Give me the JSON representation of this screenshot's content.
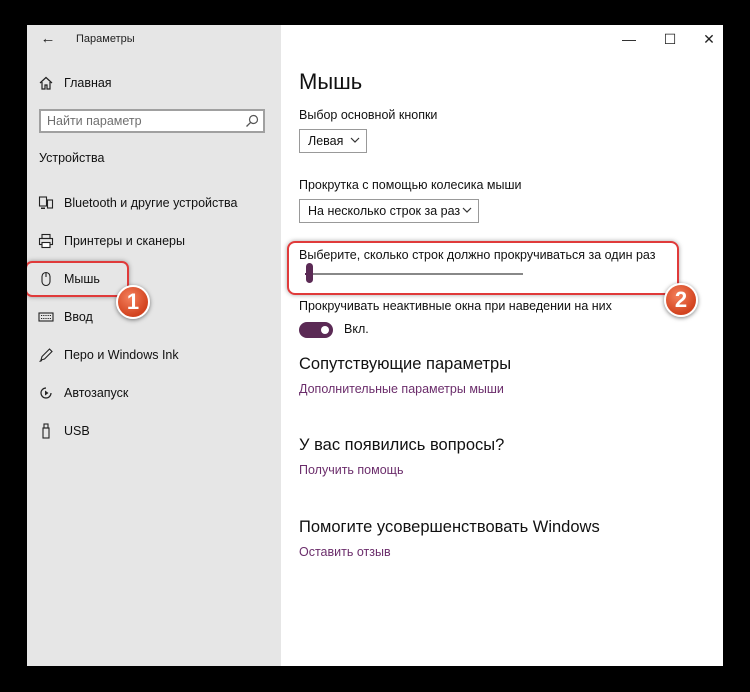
{
  "window": {
    "title": "Параметры",
    "back_icon": "back-arrow-icon",
    "controls": [
      "minimize",
      "maximize",
      "close"
    ]
  },
  "sidebar": {
    "home_label": "Главная",
    "search_placeholder": "Найти параметр",
    "section_title": "Устройства",
    "items": [
      {
        "label": "Bluetooth и другие устройства",
        "icon": "bluetooth-devices-icon"
      },
      {
        "label": "Принтеры и сканеры",
        "icon": "printer-icon"
      },
      {
        "label": "Мышь",
        "icon": "mouse-icon",
        "selected": true
      },
      {
        "label": "Ввод",
        "icon": "keyboard-icon"
      },
      {
        "label": "Перо и Windows Ink",
        "icon": "pen-icon"
      },
      {
        "label": "Автозапуск",
        "icon": "autoplay-icon"
      },
      {
        "label": "USB",
        "icon": "usb-icon"
      }
    ]
  },
  "main": {
    "title": "Мышь",
    "primary_button": {
      "label": "Выбор основной кнопки",
      "value": "Левая"
    },
    "scroll_mode": {
      "label": "Прокрутка с помощью колесика мыши",
      "value": "На несколько строк за раз"
    },
    "lines_slider": {
      "label": "Выберите, сколько строк должно прокручиваться за один раз",
      "fraction": 0.02
    },
    "inactive_scroll": {
      "label": "Прокручивать неактивные окна при наведении на них",
      "state_label": "Вкл.",
      "on": true
    },
    "related": {
      "heading": "Сопутствующие параметры",
      "link": "Дополнительные параметры мыши"
    },
    "questions": {
      "heading": "У вас появились вопросы?",
      "link": "Получить помощь"
    },
    "improve": {
      "heading": "Помогите усовершенствовать Windows",
      "link": "Оставить отзыв"
    }
  },
  "annotations": {
    "badge_1": "1",
    "badge_2": "2"
  },
  "colors": {
    "accent": "#5b2a55",
    "link": "#6b2d6b",
    "highlight": "#e03a3a",
    "badge": "#e0552f"
  }
}
